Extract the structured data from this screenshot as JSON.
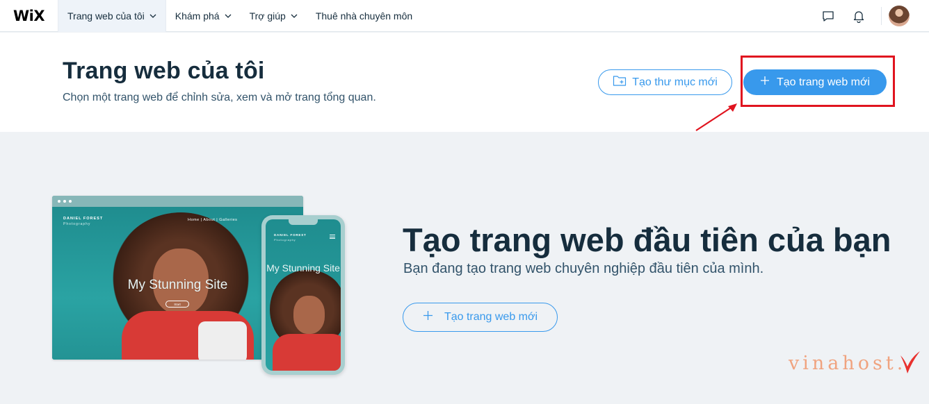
{
  "app": {
    "logo": "WiX"
  },
  "nav": {
    "items": [
      {
        "label": "Trang web của tôi",
        "active": true,
        "dropdown": true
      },
      {
        "label": "Khám phá",
        "active": false,
        "dropdown": true
      },
      {
        "label": "Trợ giúp",
        "active": false,
        "dropdown": true
      },
      {
        "label": "Thuê nhà chuyên môn",
        "active": false,
        "dropdown": false
      }
    ],
    "icons": [
      "chat-icon",
      "bell-icon",
      "avatar"
    ]
  },
  "header": {
    "title": "Trang web của tôi",
    "subtitle": "Chọn một trang web để chỉnh sửa, xem và mở trang tổng quan.",
    "new_folder_label": "Tạo thư mục mới",
    "new_site_label": "Tạo trang web mới"
  },
  "mockup": {
    "brand": "DANIEL FOREST",
    "brand_sub": "Photography",
    "nav_links": "Home   |   About   |   Galleries",
    "site_title": "My Stunning Site",
    "start_label": "Start",
    "phone_title": "My Stunning Site"
  },
  "hero": {
    "title": "Tạo trang web đầu tiên của bạn",
    "subtitle": "Bạn đang tạo trang web chuyên nghiệp đầu tiên của mình.",
    "cta_label": "Tạo trang web mới"
  },
  "watermark": {
    "text": "vinahost."
  },
  "colors": {
    "accent": "#3899ec",
    "text": "#162d3d",
    "highlight": "#e0141f",
    "background": "#eff2f5"
  }
}
